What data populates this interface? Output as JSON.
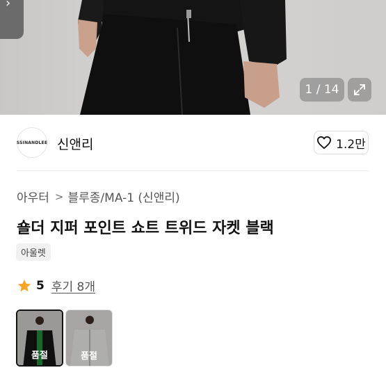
{
  "gallery": {
    "counter": "1 / 14"
  },
  "seller": {
    "logo_text": "SSINANDLEE",
    "name": "신앤리",
    "like_count": "1.2만"
  },
  "breadcrumb": [
    "아우터",
    "블루종/MA-1 (신앤리)"
  ],
  "product": {
    "title": "숄더 지퍼 포인트 쇼트 트위드 자켓 블랙",
    "badge": "아울렛",
    "rating": "5",
    "reviews": "후기 8개"
  },
  "options": [
    {
      "status": "품절",
      "color": "black/green"
    },
    {
      "status": "품절",
      "color": "white"
    }
  ],
  "colors": {
    "star": "#f5a623",
    "heart": "#111111"
  }
}
